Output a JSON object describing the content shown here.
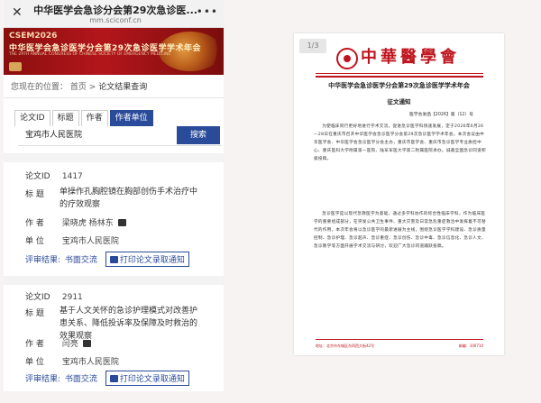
{
  "browser": {
    "title": "中华医学会急诊分会第29次急诊医...",
    "url": "mm.sciconf.cn",
    "close_glyph": "✕",
    "more_glyph": "•••"
  },
  "banner": {
    "short": "CSEM2026",
    "cn_title": "中华医学会急诊医学分会第29次急诊医学学术年会",
    "en_title": "THE 29TH ANNUAL CONGRESS OF CHINESE SOCIETY OF EMERGENCY MEDICINE"
  },
  "breadcrumb": {
    "prefix": "您现在的位置：",
    "home": "首页",
    "sep": ">",
    "current": "论文结果查询"
  },
  "search": {
    "tabs": [
      "论文ID",
      "标题",
      "作者",
      "作者单位"
    ],
    "active_tab": "作者单位",
    "value": "宝鸡市人民医院",
    "button": "搜索"
  },
  "field_labels": {
    "id": "论文ID",
    "title": "标    题",
    "author": "作    者",
    "unit": "单    位",
    "review": "评审结果:"
  },
  "results": [
    {
      "id": "1417",
      "title": "单操作孔胸腔镜在胸部创伤手术治疗中的疗效观察",
      "authors": "梁晓虎  杨林东",
      "unit": "宝鸡市人民医院",
      "review": "书面交流",
      "print_label": "打印论文录取通知"
    },
    {
      "id": "2911",
      "title": "基于人文关怀的急诊护理模式对改善护患关系、降低投诉率及保障及时救治的效果观察",
      "authors": "闫亮",
      "unit": "宝鸡市人民医院",
      "review": "书面交流",
      "print_label": "打印论文录取通知"
    }
  ],
  "document": {
    "page": "1/3",
    "brand": "中華醫學會",
    "title": "中华医学会急诊医学分会第29次急诊医学学术年会",
    "subtitle": "征文通知",
    "doc_no": "医学会发函【2026】第（12）号",
    "paragraphs": [
      "为使临床同行更好地进行学术交流，促进急诊医学科快速发展，定于2026年6月26—28日在重庆市召开中华医学会急诊医学分会第29次急诊医学学术年会。本次会议由中华医学会、中华医学会急诊医学分会主办，重庆市医学会、重庆市急诊医学专业质控中心、重庆医科大学附属第一医院、陆军军医大学第二附属医院承办。诚邀全国急诊同道积极投稿。",
      "急诊医学是以现代急救医学为基础，通过多学科协作的综合性临床学科，作为临床医学的重要组成部分，在突发公共卫生事件、重大灾害及日常急危重症救治中发挥着不可替代的作用。本次年会将以急诊医学的最新进展为主线，围绕急诊医学学科建设、急诊质量控制、急诊护理、急诊超声、急诊重症、急诊创伤、急诊中毒、急诊信息化、急诊人文、急诊教学等方面开展学术交流与研讨，欢迎广大急诊同道踊跃投稿。"
    ],
    "footer_left": "地址：北京市东城区东四西大街42号",
    "footer_right": "邮编：100710"
  }
}
